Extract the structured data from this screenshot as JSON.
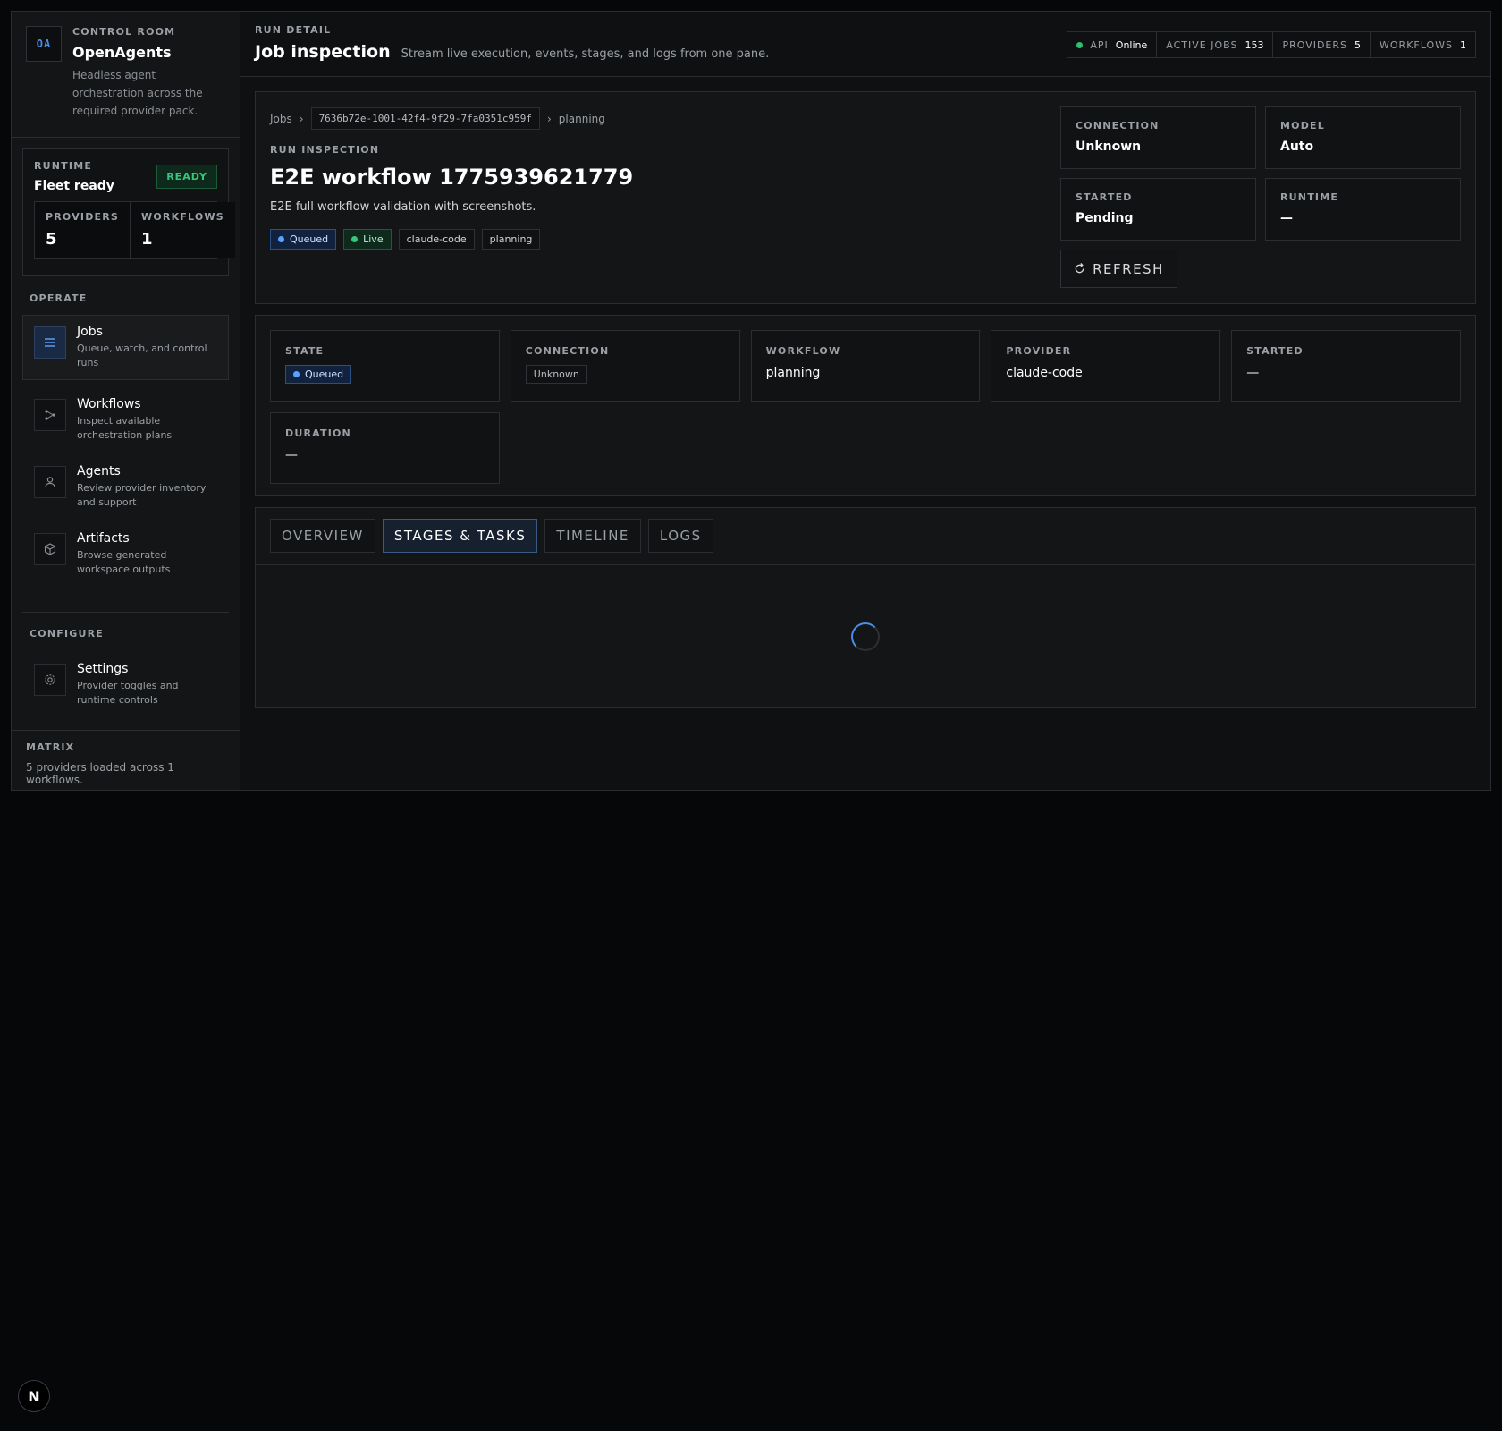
{
  "sidebar": {
    "logo": "OA",
    "eyebrow": "CONTROL ROOM",
    "app_name": "OpenAgents",
    "description": "Headless agent orchestration across the required provider pack.",
    "runtime": {
      "label": "RUNTIME",
      "title": "Fleet ready",
      "badge": "READY",
      "stats": [
        {
          "label": "PROVIDERS",
          "value": "5"
        },
        {
          "label": "WORKFLOWS",
          "value": "1"
        }
      ]
    },
    "operate_label": "OPERATE",
    "nav": [
      {
        "title": "Jobs",
        "sub": "Queue, watch, and control runs",
        "icon": "list-icon"
      },
      {
        "title": "Workflows",
        "sub": "Inspect available orchestration plans",
        "icon": "workflow-icon"
      },
      {
        "title": "Agents",
        "sub": "Review provider inventory and support",
        "icon": "user-icon"
      },
      {
        "title": "Artifacts",
        "sub": "Browse generated workspace outputs",
        "icon": "cube-icon"
      }
    ],
    "configure_label": "CONFIGURE",
    "settings": {
      "title": "Settings",
      "sub": "Provider toggles and runtime controls",
      "icon": "gear-icon"
    },
    "matrix": {
      "label": "MATRIX",
      "text": "5 providers loaded across 1 workflows."
    }
  },
  "topbar": {
    "eyebrow": "RUN DETAIL",
    "title": "Job inspection",
    "subtitle": "Stream live execution, events, stages, and logs from one pane.",
    "status": [
      {
        "label": "API",
        "value": "Online"
      },
      {
        "label": "ACTIVE JOBS",
        "value": "153"
      },
      {
        "label": "PROVIDERS",
        "value": "5"
      },
      {
        "label": "WORKFLOWS",
        "value": "1"
      }
    ]
  },
  "hero": {
    "crumbs": {
      "root": "Jobs",
      "id": "7636b72e-1001-42f4-9f29-7fa0351c959f",
      "leaf": "planning"
    },
    "eyebrow": "RUN INSPECTION",
    "title": "E2E workflow 1775939621779",
    "description": "E2E full workflow validation with screenshots.",
    "chips": [
      "Queued",
      "Live",
      "claude-code",
      "planning"
    ],
    "meta": [
      {
        "label": "CONNECTION",
        "value": "Unknown"
      },
      {
        "label": "MODEL",
        "value": "Auto"
      },
      {
        "label": "STARTED",
        "value": "Pending"
      },
      {
        "label": "RUNTIME",
        "value": "—"
      }
    ],
    "refresh_label": "REFRESH"
  },
  "stats": [
    {
      "label": "STATE",
      "value": "Queued"
    },
    {
      "label": "CONNECTION",
      "value": "Unknown"
    },
    {
      "label": "WORKFLOW",
      "value": "planning"
    },
    {
      "label": "PROVIDER",
      "value": "claude-code"
    },
    {
      "label": "STARTED",
      "value": "—"
    },
    {
      "label": "DURATION",
      "value": "—"
    }
  ],
  "tabs": [
    "OVERVIEW",
    "STAGES & TASKS",
    "TIMELINE",
    "LOGS"
  ],
  "active_tab": "STAGES & TASKS",
  "corner_badge": "N",
  "colors": {
    "accent": "#4a8de6",
    "ready": "#37c77a",
    "queued": "#5aa2ff",
    "background": "#060709"
  }
}
